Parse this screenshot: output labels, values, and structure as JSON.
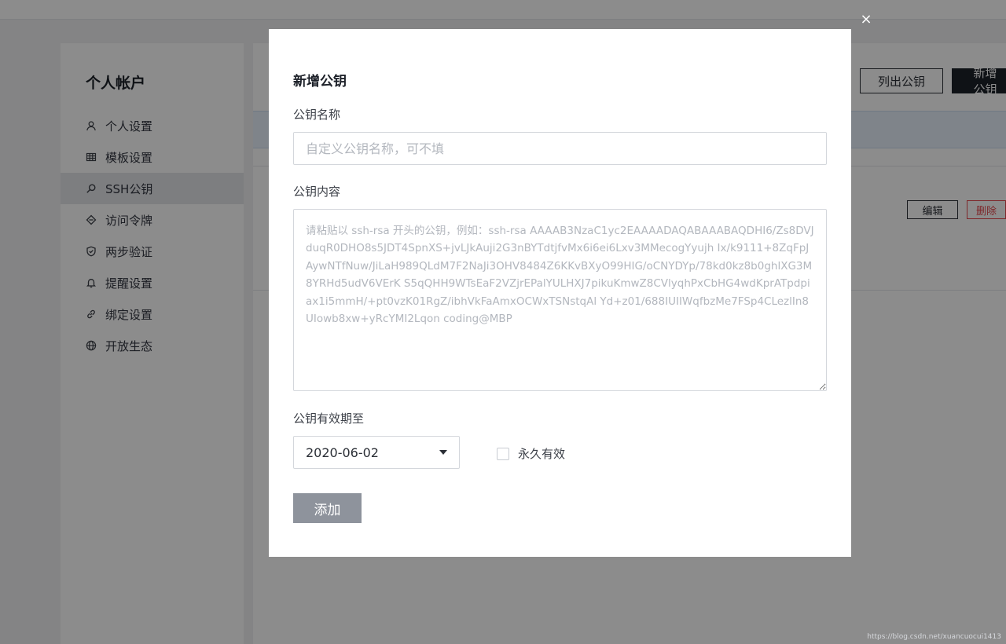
{
  "sidebar": {
    "title": "个人帐户",
    "items": [
      {
        "label": "个人设置",
        "icon": "user-icon"
      },
      {
        "label": "模板设置",
        "icon": "grid-icon"
      },
      {
        "label": "SSH公钥",
        "icon": "key-search-icon",
        "active": true
      },
      {
        "label": "访问令牌",
        "icon": "token-icon"
      },
      {
        "label": "两步验证",
        "icon": "shield-icon"
      },
      {
        "label": "提醒设置",
        "icon": "bell-icon"
      },
      {
        "label": "绑定设置",
        "icon": "link-icon"
      },
      {
        "label": "开放生态",
        "icon": "globe-icon"
      }
    ]
  },
  "content": {
    "list_keys_button": "列出公钥",
    "add_key_button": "新增公钥",
    "edit_button": "编辑",
    "delete_button": "删除"
  },
  "modal": {
    "title": "新增公钥",
    "name_label": "公钥名称",
    "name_placeholder": "自定义公钥名称，可不填",
    "content_label": "公钥内容",
    "content_placeholder": "请粘贴以 ssh-rsa 开头的公钥，例如：ssh-rsa AAAAB3NzaC1yc2EAAAADAQABAAABAQDHI6/Zs8DVJduqR0DHO8s5JDT4SpnXS+jvLJkAuji2G3nBYTdtjfvMx6i6ei6Lxv3MMecogYyujh Ix/k9111+8ZqFpJAywNTfNuw/JiLaH989QLdM7F2NaJi3OHV8484Z6KKvBXyO99HIG/oCNYDYp/78kd0kz8b0ghlXG3M8YRHd5udV6VErK S5qQHH9WTsEaF2VZjrEPalYULHXJ7pikuKmwZ8CVlyqhPxCbHG4wdKprATpdpiax1i5mmH/+pt0vzK01RgZ/ibhVkFaAmxOCWxTSNstqAl Yd+z01/688IUIIWqfbzMe7FSp4CLezlIn8UIowb8xw+yRcYMI2Lqon coding@MBP",
    "expiry_label": "公钥有效期至",
    "expiry_value": "2020-06-02",
    "permanent_label": "永久有效",
    "permanent_checked": false,
    "submit_button": "添加",
    "close_symbol": "×"
  },
  "watermark": "https://blog.csdn.net/xuancuocui1413"
}
